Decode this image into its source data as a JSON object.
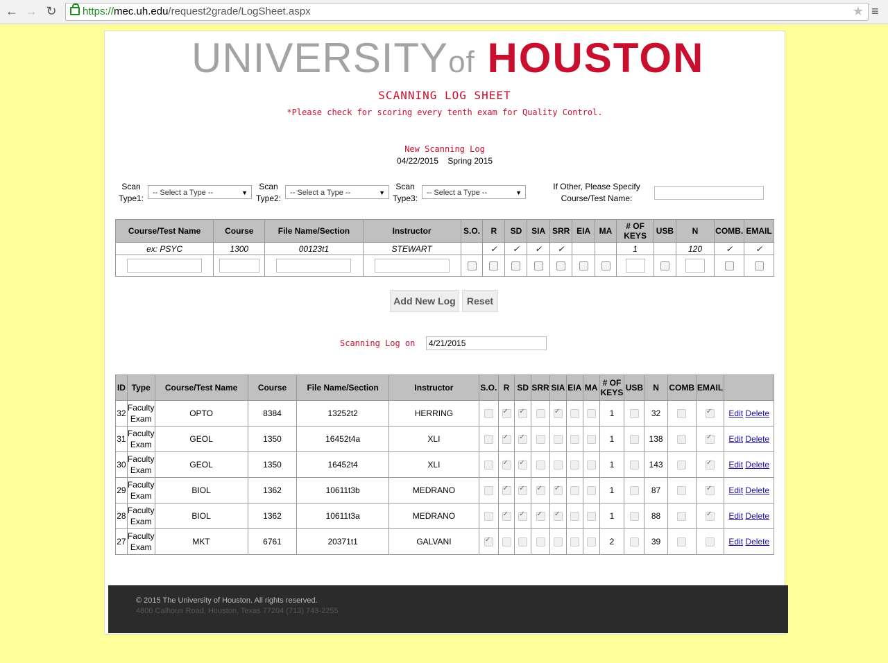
{
  "browser": {
    "url_proto": "https://",
    "url_host": "mec.uh.edu",
    "url_path": "/request2grade/LogSheet.aspx"
  },
  "logo": {
    "university": "UNIVERSITY",
    "of": "of",
    "houston": "HOUSTON"
  },
  "header": {
    "title": "SCANNING LOG SHEET",
    "subtitle": "*Please check for scoring every tenth exam for Quality Control.",
    "new_log": "New Scanning Log",
    "date": "04/22/2015",
    "term": "Spring 2015"
  },
  "scan_types": [
    {
      "label1": "Scan",
      "label2": "Type1:",
      "value": "-- Select a Type --"
    },
    {
      "label1": "Scan",
      "label2": "Type2:",
      "value": "-- Select a Type --"
    },
    {
      "label1": "Scan",
      "label2": "Type3:",
      "value": "-- Select a Type --"
    }
  ],
  "other": {
    "label1": "If Other, Please Specify",
    "label2": "Course/Test Name:"
  },
  "entry_table": {
    "headers": [
      "Course/Test Name",
      "Course",
      "File Name/Section",
      "Instructor",
      "S.O.",
      "R",
      "SD",
      "SIA",
      "SRR",
      "EIA",
      "MA",
      "# OF KEYS",
      "USB",
      "N",
      "COMB.",
      "EMAIL"
    ],
    "example": [
      "ex: PSYC",
      "1300",
      "00123t1",
      "STEWART",
      "",
      "✓",
      "✓",
      "✓",
      "✓",
      "",
      "",
      "1",
      "",
      "120",
      "✓",
      "✓"
    ]
  },
  "buttons": {
    "add": "Add New Log",
    "reset": "Reset"
  },
  "log_on": {
    "label": "Scanning Log on",
    "value": "4/21/2015"
  },
  "log_table": {
    "headers": [
      "ID",
      "Type",
      "Course/Test Name",
      "Course",
      "File Name/Section",
      "Instructor",
      "S.O.",
      "R",
      "SD",
      "SRR",
      "SIA",
      "EIA",
      "MA",
      "# OF KEYS",
      "USB",
      "N",
      "COMB",
      "EMAIL",
      ""
    ],
    "edit_label": "Edit",
    "delete_label": "Delete",
    "rows": [
      {
        "id": "32",
        "type": "Faculty Exam",
        "name": "OPTO",
        "course": "8384",
        "file": "13252t2",
        "instructor": "HERRING",
        "so": false,
        "r": true,
        "sd": true,
        "srr": false,
        "sia": true,
        "eia": false,
        "ma": false,
        "keys": "1",
        "usb": false,
        "n": "32",
        "comb": false,
        "email": true
      },
      {
        "id": "31",
        "type": "Faculty Exam",
        "name": "GEOL",
        "course": "1350",
        "file": "16452t4a",
        "instructor": "XLI",
        "so": false,
        "r": true,
        "sd": true,
        "srr": false,
        "sia": false,
        "eia": false,
        "ma": false,
        "keys": "1",
        "usb": false,
        "n": "138",
        "comb": false,
        "email": true
      },
      {
        "id": "30",
        "type": "Faculty Exam",
        "name": "GEOL",
        "course": "1350",
        "file": "16452t4",
        "instructor": "XLI",
        "so": false,
        "r": true,
        "sd": true,
        "srr": false,
        "sia": false,
        "eia": false,
        "ma": false,
        "keys": "1",
        "usb": false,
        "n": "143",
        "comb": false,
        "email": true
      },
      {
        "id": "29",
        "type": "Faculty Exam",
        "name": "BIOL",
        "course": "1362",
        "file": "10611t3b",
        "instructor": "MEDRANO",
        "so": false,
        "r": true,
        "sd": true,
        "srr": true,
        "sia": true,
        "eia": false,
        "ma": false,
        "keys": "1",
        "usb": false,
        "n": "87",
        "comb": false,
        "email": true
      },
      {
        "id": "28",
        "type": "Faculty Exam",
        "name": "BIOL",
        "course": "1362",
        "file": "10611t3a",
        "instructor": "MEDRANO",
        "so": false,
        "r": true,
        "sd": true,
        "srr": true,
        "sia": true,
        "eia": false,
        "ma": false,
        "keys": "1",
        "usb": false,
        "n": "88",
        "comb": false,
        "email": true
      },
      {
        "id": "27",
        "type": "Faculty Exam",
        "name": "MKT",
        "course": "6761",
        "file": "20371t1",
        "instructor": "GALVANI",
        "so": true,
        "r": false,
        "sd": false,
        "srr": false,
        "sia": false,
        "eia": false,
        "ma": false,
        "keys": "2",
        "usb": false,
        "n": "39",
        "comb": false,
        "email": false
      }
    ]
  },
  "footer": {
    "copyright": "© 2015 The University of Houston. All rights reserved.",
    "address": "4800 Calhoun Road, Houston, Texas 77204 (713) 743-2255"
  },
  "colors": {
    "brand_red": "#c8102e",
    "background": "#ffff99",
    "footer": "#2b2b2b"
  }
}
